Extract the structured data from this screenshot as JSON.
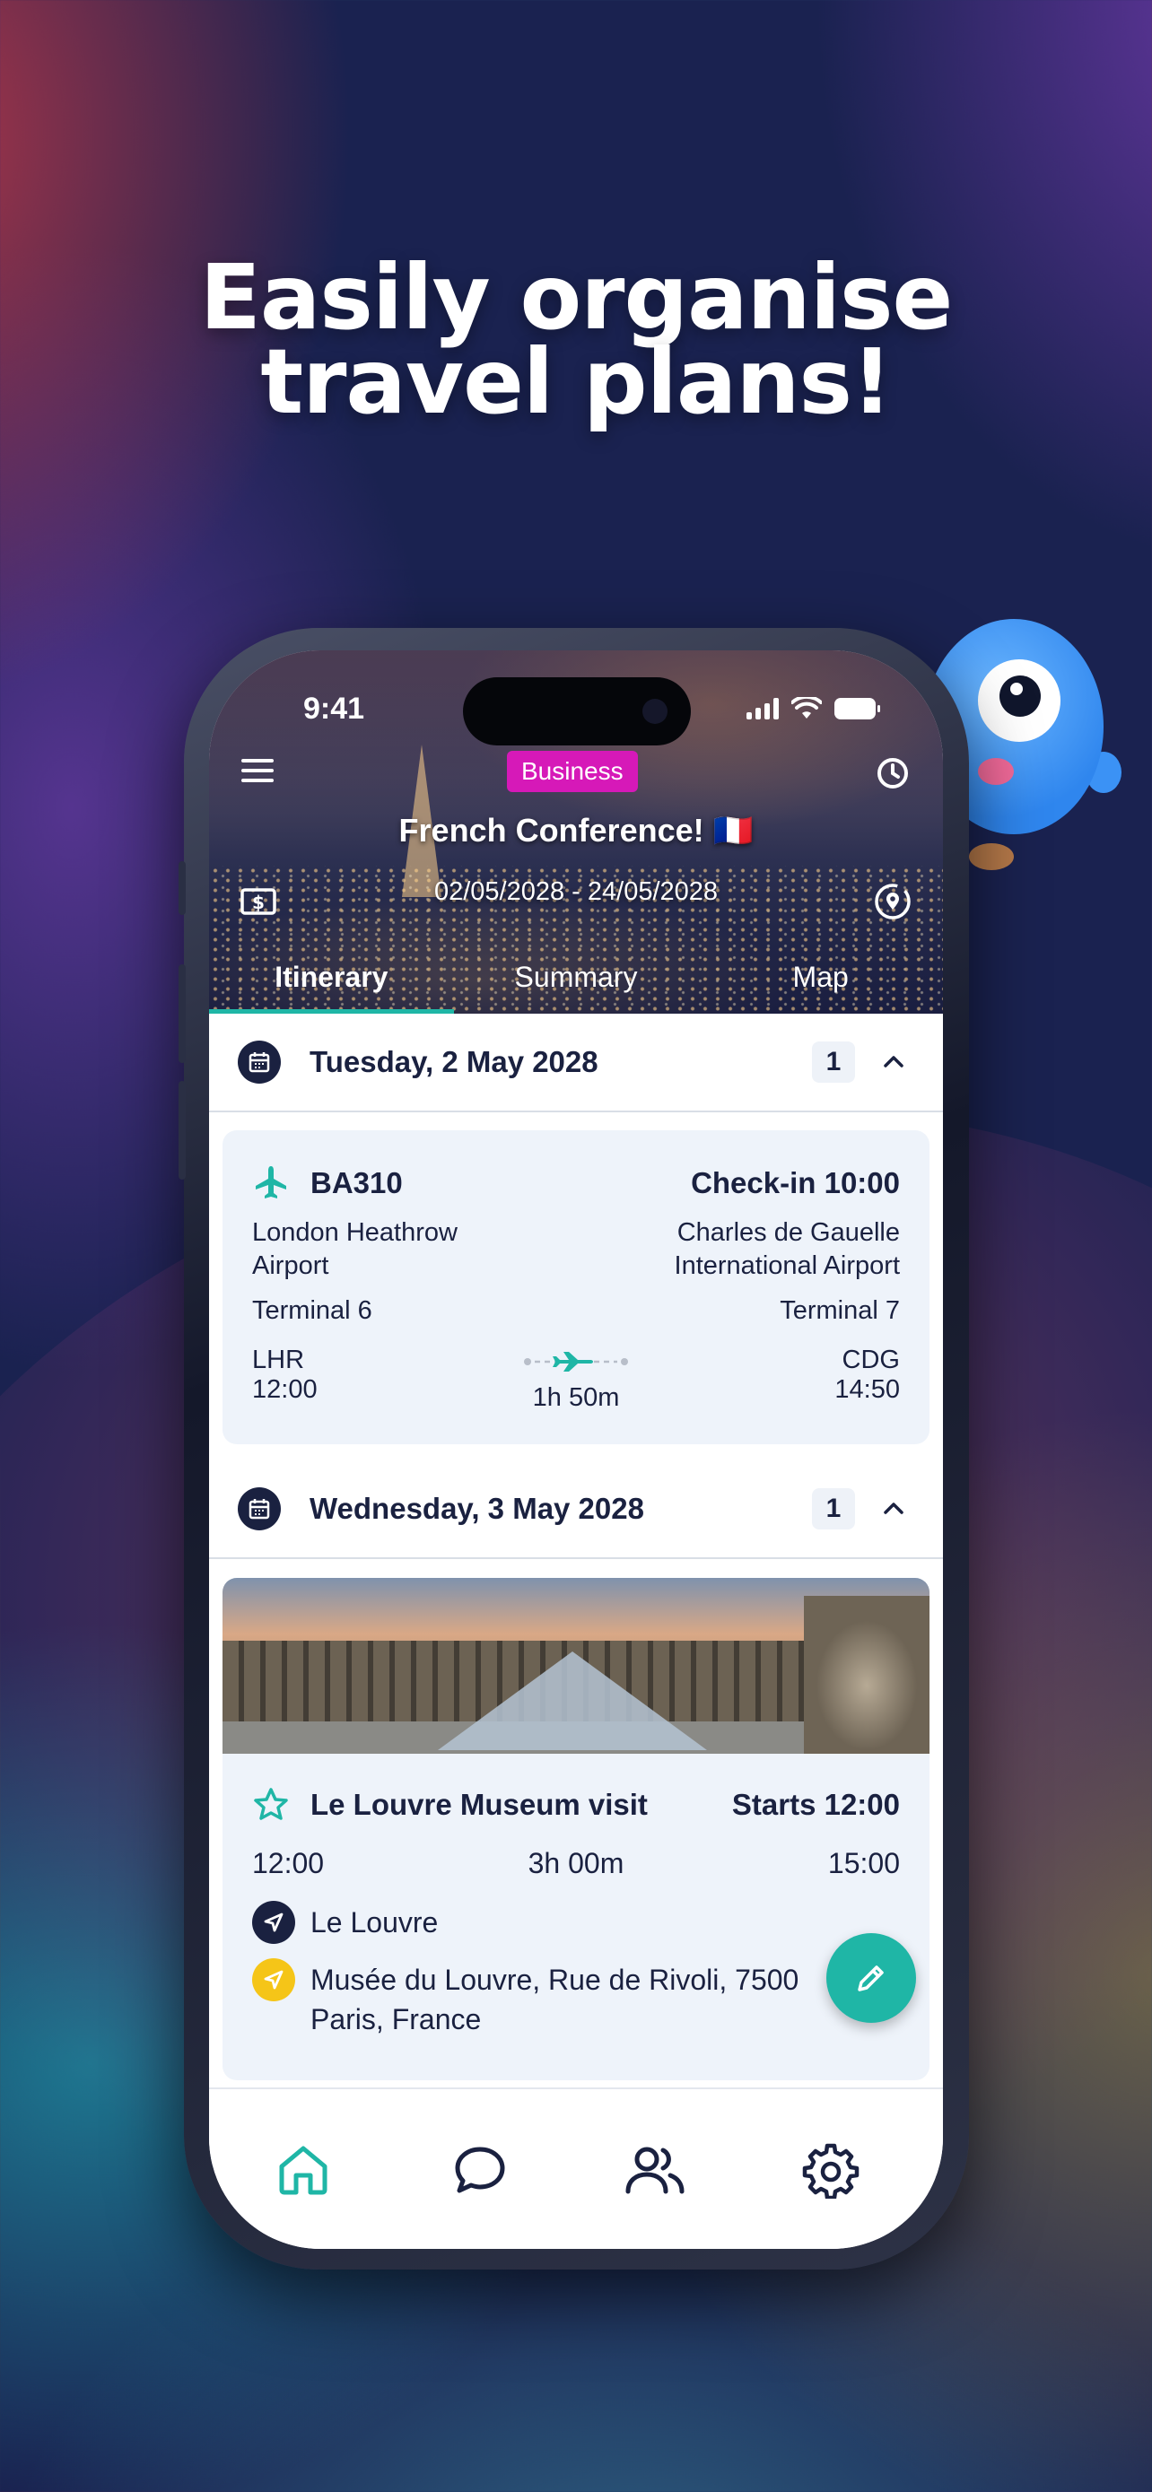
{
  "headline": {
    "line1": "Easily organise",
    "line2": "travel plans!"
  },
  "status_bar": {
    "time": "9:41"
  },
  "trip": {
    "badge": "Business",
    "title": "French Conference! 🇫🇷",
    "dates": "02/05/2028 - 24/05/2028"
  },
  "tabs": [
    {
      "label": "Itinerary",
      "active": true
    },
    {
      "label": "Summary",
      "active": false
    },
    {
      "label": "Map",
      "active": false
    }
  ],
  "days": [
    {
      "date": "Tuesday, 2 May 2028",
      "count": "1",
      "flight": {
        "number": "BA310",
        "checkin": "Check-in 10:00",
        "from_airport": [
          "London Heathrow",
          "Airport"
        ],
        "to_airport": [
          "Charles de Gauelle",
          "International Airport"
        ],
        "from_terminal": "Terminal 6",
        "to_terminal": "Terminal 7",
        "from_code": "LHR",
        "from_time": "12:00",
        "to_code": "CDG",
        "to_time": "14:50",
        "duration": "1h 50m"
      }
    },
    {
      "date": "Wednesday, 3 May 2028",
      "count": "1",
      "activity": {
        "title": "Le Louvre Museum visit",
        "starts": "Starts 12:00",
        "start_time": "12:00",
        "duration": "3h 00m",
        "end_time": "15:00",
        "place": "Le Louvre",
        "address_line1": "Musée du Louvre, Rue de Rivoli, 7500",
        "address_line2": "Paris, France"
      }
    }
  ],
  "colors": {
    "accent": "#1fb6a6",
    "navy": "#1a2140",
    "badge": "#d619b8",
    "pin_yellow": "#f5c518"
  }
}
